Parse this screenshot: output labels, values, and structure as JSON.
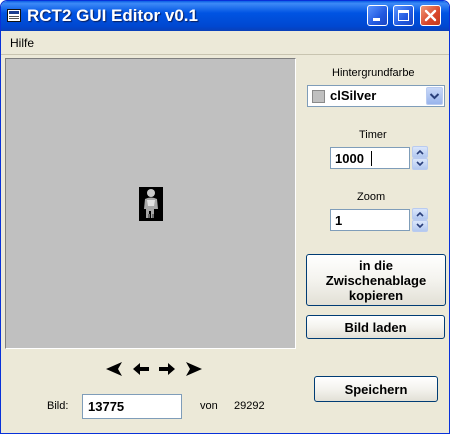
{
  "window": {
    "title": "RCT2 GUI Editor v0.1"
  },
  "menu": {
    "items": [
      "Hilfe"
    ]
  },
  "background": {
    "label": "Hintergrundfarbe",
    "value": "clSilver",
    "swatch_color": "#c0c0c0"
  },
  "timer": {
    "label": "Timer",
    "value": "1000"
  },
  "zoom": {
    "label": "Zoom",
    "value": "1"
  },
  "buttons": {
    "copy_line1": "in die",
    "copy_line2": "Zwischenablage",
    "copy_line3": "kopieren",
    "load": "Bild laden",
    "save": "Speichern"
  },
  "navigation": {
    "icons": [
      "first-icon",
      "previous-icon",
      "next-icon",
      "last-icon"
    ]
  },
  "image_index": {
    "label": "Bild:",
    "value": "13775",
    "of_label": "von",
    "total": "29292"
  },
  "colors": {
    "titlebar": "#0054e3",
    "canvas": "#c0c0c0",
    "close_button": "#d9462a"
  }
}
